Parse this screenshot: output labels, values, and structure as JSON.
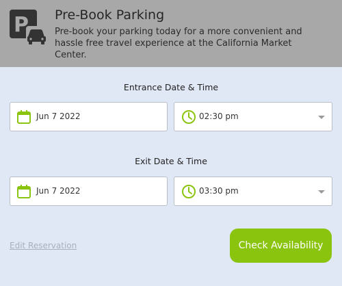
{
  "header": {
    "icon": "parking-car-icon",
    "title": "Pre-Book Parking",
    "description": "Pre-book your parking today for a more convenient and hassle free travel experience at the California Market Center."
  },
  "entrance": {
    "label": "Entrance Date & Time",
    "date": "Jun 7 2022",
    "time": "02:30 pm"
  },
  "exit": {
    "label": "Exit Date & Time",
    "date": "Jun 7 2022",
    "time": "03:30 pm"
  },
  "actions": {
    "edit_label": "Edit Reservation",
    "check_label": "Check Availability"
  },
  "colors": {
    "accent": "#8bc40f",
    "header_bg": "#a8a8a8",
    "panel_bg": "#e1e8f5"
  }
}
